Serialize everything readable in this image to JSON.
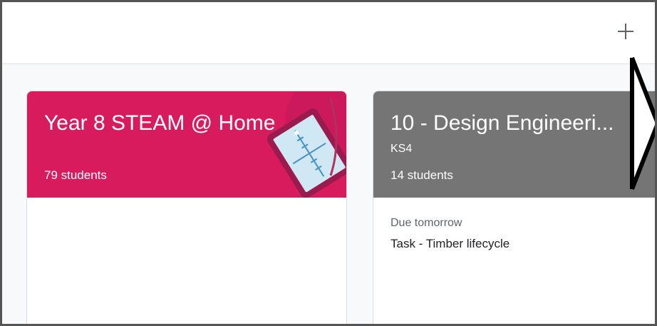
{
  "toolbar": {
    "add_icon": "plus-icon"
  },
  "classes": [
    {
      "title": "Year 8 STEAM @ Home",
      "section": "",
      "students": "79 students",
      "color": "#d81b5d",
      "illustration": "tablet-graph-icon"
    },
    {
      "title": "10 - Design Engineeri...",
      "section": "KS4",
      "students": "14 students",
      "color": "#757575",
      "due_label": "Due tomorrow",
      "due_task": "Task - Timber lifecycle"
    }
  ],
  "navigation": {
    "next_icon": "chevron-right-icon"
  }
}
